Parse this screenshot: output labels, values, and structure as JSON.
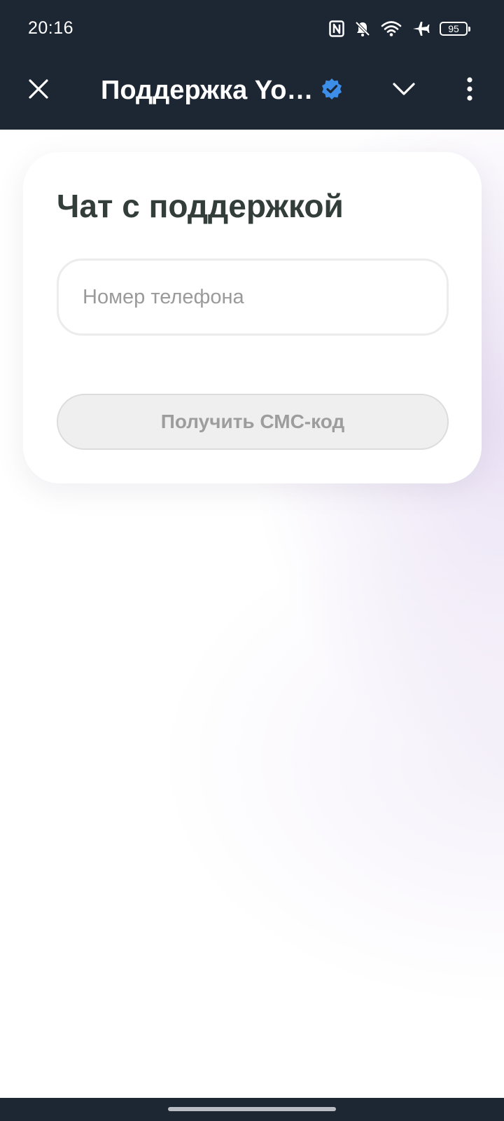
{
  "status_bar": {
    "time": "20:16",
    "battery_level": "95",
    "icons": [
      "nfc-icon",
      "bell-off-icon",
      "wifi-icon",
      "airplane-icon",
      "battery-icon"
    ]
  },
  "app_bar": {
    "title": "Поддержка Yo…",
    "verified_icon": "verified-badge-icon",
    "verified_color": "#3d8ee8",
    "close_icon": "close-icon",
    "collapse_icon": "chevron-down-icon",
    "menu_icon": "more-vertical-icon",
    "background": "#1d2633"
  },
  "card": {
    "title": "Чат с поддержкой",
    "phone_input": {
      "placeholder": "Номер телефона",
      "value": ""
    },
    "submit_button": {
      "label": "Получить СМС-код",
      "state": "disabled"
    }
  }
}
